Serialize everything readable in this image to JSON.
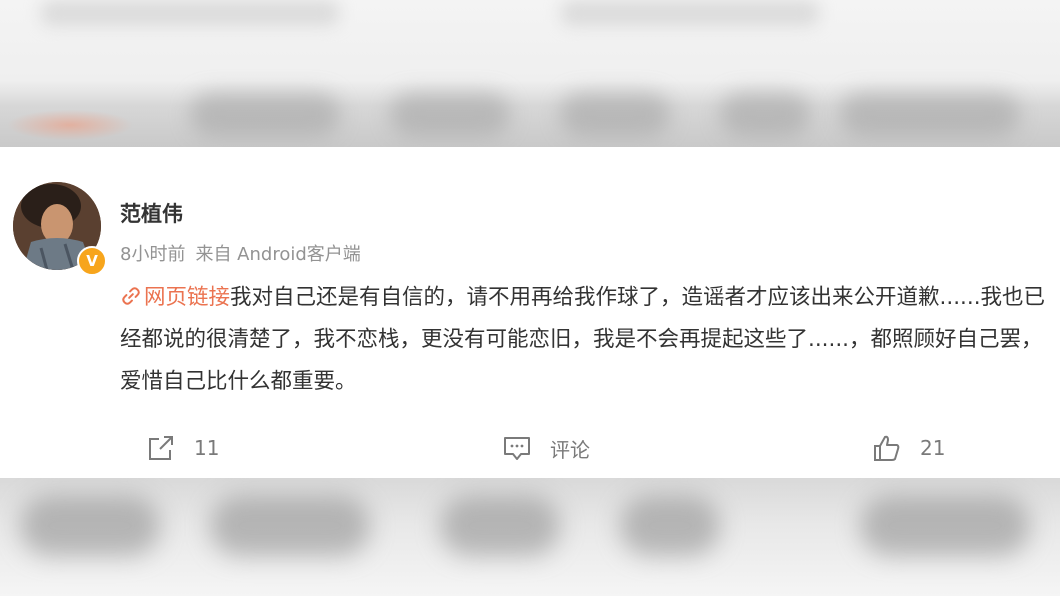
{
  "post": {
    "author": "范植伟",
    "verified_badge": "V",
    "time": "8小时前",
    "source": "来自 Android客户端",
    "link_text": "网页链接",
    "body": "我对自己还是有自信的，请不用再给我作球了，造谣者才应该出来公开道歉......我也已经都说的很清楚了，我不恋栈，更没有可能恋旧，我是不会再提起这些了......，都照顾好自己罢，爱惜自己比什么都重要。",
    "link_color": "#eb7350",
    "badge_color": "#f7a51c"
  },
  "actions": {
    "repost_count": "11",
    "comment_label": "评论",
    "like_count": "21"
  },
  "icons": {
    "link": "link-chain-icon",
    "repost": "repost-icon",
    "comment": "comment-icon",
    "like": "thumbs-up-icon"
  }
}
